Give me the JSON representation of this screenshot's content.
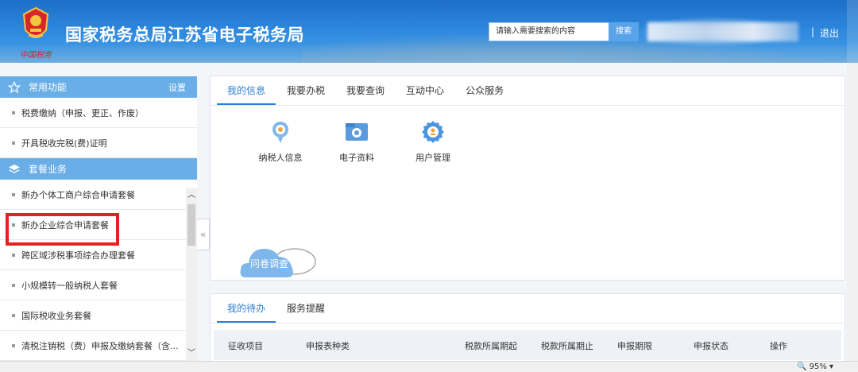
{
  "header": {
    "logo_caption": "中国税务",
    "title": "国家税务总局江苏省电子税务局",
    "search_placeholder": "请输入需要搜索的内容",
    "search_button": "搜索",
    "separator": "|",
    "logout": "退出"
  },
  "sidebar": {
    "favorites": {
      "title": "常用功能",
      "settings": "设置",
      "items": [
        {
          "label": "税费缴纳（申报、更正、作废）"
        },
        {
          "label": "开具税收完税(费)证明"
        }
      ]
    },
    "packages": {
      "title": "套餐业务",
      "items": [
        {
          "label": "新办个体工商户综合申请套餐"
        },
        {
          "label": "新办企业综合申请套餐"
        },
        {
          "label": "跨区域涉税事项综合办理套餐"
        },
        {
          "label": "小规模转一般纳税人套餐"
        },
        {
          "label": "国际税收业务套餐"
        },
        {
          "label": "清税注销税（费）申报及缴纳套餐（含..."
        }
      ]
    },
    "collapse": "«"
  },
  "main": {
    "tabs": [
      {
        "label": "我的信息",
        "active": true
      },
      {
        "label": "我要办税",
        "active": false
      },
      {
        "label": "我要查询",
        "active": false
      },
      {
        "label": "互动中心",
        "active": false
      },
      {
        "label": "公众服务",
        "active": false
      }
    ],
    "tiles": [
      {
        "label": "纳税人信息",
        "icon": "taxpayer-info-icon"
      },
      {
        "label": "电子资料",
        "icon": "e-documents-icon"
      },
      {
        "label": "用户管理",
        "icon": "user-management-icon"
      }
    ],
    "survey": "问卷调查"
  },
  "todo": {
    "tabs": [
      {
        "label": "我的待办",
        "active": true
      },
      {
        "label": "服务提醒",
        "active": false
      }
    ],
    "columns": [
      "征收项目",
      "申报表种类",
      "税款所属期起",
      "税款所属期止",
      "申报期限",
      "申报状态",
      "操作"
    ]
  },
  "status": {
    "zoom": "95%"
  },
  "colors": {
    "accent": "#2e7fd0",
    "sidebar_header": "#6aaee8",
    "highlight": "#e52020"
  }
}
